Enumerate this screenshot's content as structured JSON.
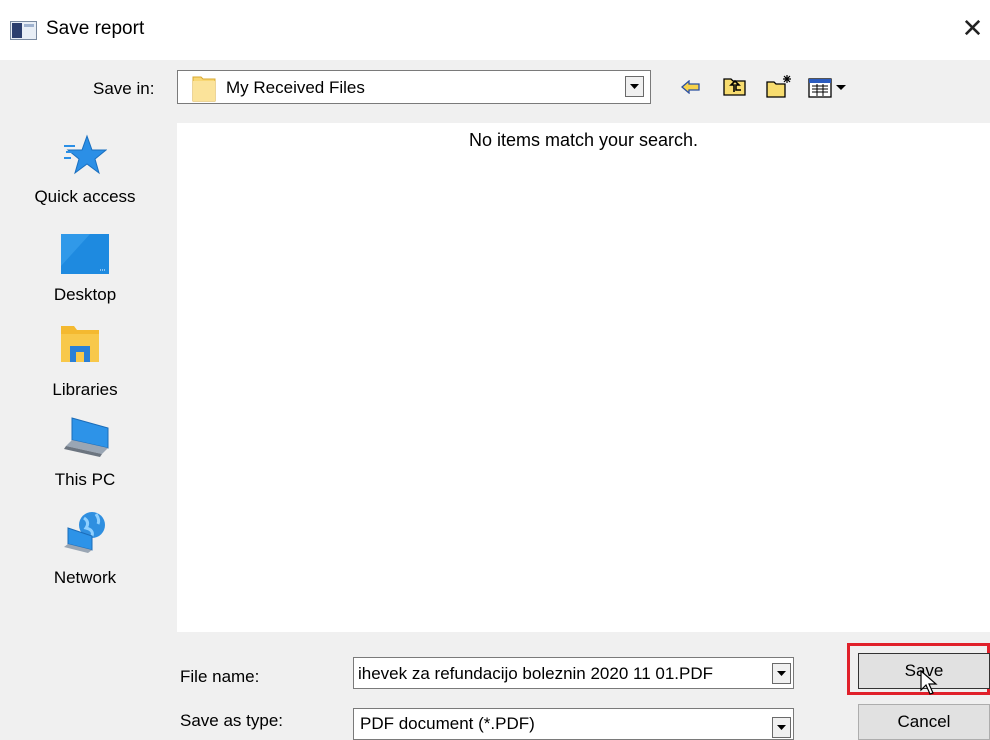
{
  "window": {
    "title": "Save report",
    "close_glyph": "✕"
  },
  "save_in": {
    "label": "Save in:",
    "value": "My Received Files",
    "icon": "folder-icon"
  },
  "toolbar": {
    "icons": [
      "back-arrow-icon",
      "up-folder-icon",
      "new-folder-icon",
      "view-menu-icon"
    ]
  },
  "places": [
    {
      "label": "Quick access",
      "icon": "star-icon"
    },
    {
      "label": "Desktop",
      "icon": "desktop-icon"
    },
    {
      "label": "Libraries",
      "icon": "libraries-icon"
    },
    {
      "label": "This PC",
      "icon": "computer-icon"
    },
    {
      "label": "Network",
      "icon": "network-icon"
    }
  ],
  "file_list": {
    "empty_message": "No items match your search."
  },
  "file_name": {
    "label": "File name:",
    "value": "ihevek za refundacijo boleznin 2020 11 01.PDF"
  },
  "save_as_type": {
    "label": "Save as type:",
    "value": "PDF document (*.PDF)"
  },
  "buttons": {
    "save": "Save",
    "cancel": "Cancel"
  },
  "colors": {
    "highlight": "#e0202a",
    "accent": "#1e90e0"
  }
}
